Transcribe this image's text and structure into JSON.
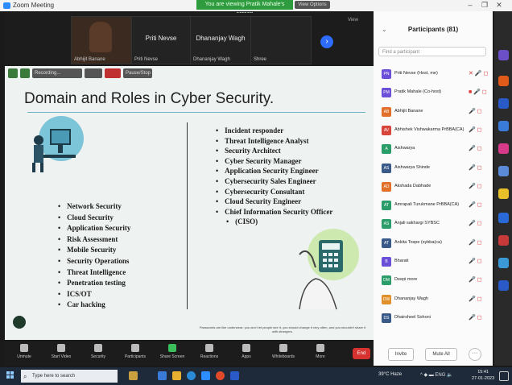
{
  "window": {
    "title": "Zoom Meeting",
    "viewing_banner": "You are viewing Pratik Mahale's screen",
    "view_options": "View Options",
    "controls": [
      "–",
      "❐",
      "✕"
    ]
  },
  "video_strip": {
    "tiles": [
      {
        "name": "Abhijit Banane",
        "big": ""
      },
      {
        "name": "Priti Nevse",
        "big": "Priti Nevse"
      },
      {
        "name": "Dhananjay Wagh",
        "big": "Dhananjay Wagh"
      },
      {
        "name": "Shree",
        "big": ""
      }
    ],
    "view_label": "View"
  },
  "slide_controls": [
    "",
    "",
    "Recording...",
    "",
    "Pause/Stop"
  ],
  "slide": {
    "title": "Domain and Roles in Cyber Security.",
    "left_bullets": [
      "Network Security",
      "Cloud Security",
      "Application Security",
      "Risk Assessment",
      "Mobile Security",
      "Security Operations",
      "Threat Intelligence",
      "Penetration testing",
      "ICS/OT",
      "Car hacking"
    ],
    "right_bullets": [
      "Incident responder",
      "Threat Intelligence Analyst",
      "Security Architect",
      "Cyber Security Manager",
      "Application Security Engineer",
      "Cybersecurity Sales Engineer",
      "Cybersecurity Consultant",
      "Cloud Security Engineer",
      "Chief Information Security Officer"
    ],
    "right_tail": "(CISO)",
    "footnote": "Passwords are like underwear: you don't let people see it, you should change it very often, and you shouldn't share it with strangers."
  },
  "participants": {
    "title": "Participants (81)",
    "search_placeholder": "Find a participant",
    "list": [
      {
        "initials": "PN",
        "name": "Priti Nevse (Host, me)",
        "color": "#6b4fd8",
        "icon": "✕ 🎤 ◻"
      },
      {
        "initials": "PM",
        "name": "Pratik Mahale (Co-host)",
        "color": "#6b4fd8",
        "icon": "■ 🎤 ◻"
      },
      {
        "initials": "AB",
        "name": "Abhijit Banane",
        "color": "#e0702a",
        "icon": "🎤 ◻"
      },
      {
        "initials": "AV",
        "name": "Abhishek Vishwakarma PrBBA(CA)",
        "color": "#d8453a",
        "icon": "🎤 ◻"
      },
      {
        "initials": "A",
        "name": "Aishwarya",
        "color": "#2a9d6a",
        "icon": "🎤 ◻"
      },
      {
        "initials": "AS",
        "name": "Aishwarya Shinde",
        "color": "#3a5a8a",
        "icon": "🎤 ◻"
      },
      {
        "initials": "AD",
        "name": "Akshada Dabhade",
        "color": "#e0702a",
        "icon": "🎤 ◻"
      },
      {
        "initials": "AT",
        "name": "Amrapali Turukmane PrBBA(CA)",
        "color": "#2a9d6a",
        "icon": "🎤 ◻"
      },
      {
        "initials": "AS",
        "name": "Anjali sakhargi SYBSC",
        "color": "#2a9d6a",
        "icon": "🎤 ◻"
      },
      {
        "initials": "AT",
        "name": "Ankita Tospe (sybba(ca)",
        "color": "#3a5a8a",
        "icon": "🎤 ◻"
      },
      {
        "initials": "B",
        "name": "Bharati",
        "color": "#6b4fd8",
        "icon": "🎤 ◻"
      },
      {
        "initials": "DM",
        "name": "Deepi more",
        "color": "#2a9d6a",
        "icon": "🎤 ◻"
      },
      {
        "initials": "DW",
        "name": "Dhananjay Wagh",
        "color": "#e0902a",
        "icon": "🎤 ◻"
      },
      {
        "initials": "DS",
        "name": "Dhairsheel Sohoni",
        "color": "#3a5a8a",
        "icon": "🎤 ◻"
      }
    ],
    "invite": "Invite",
    "mute_all": "Mute All",
    "more": "···"
  },
  "toolbar": {
    "items": [
      "Unmute",
      "Start Video",
      "Security",
      "Participants",
      "Share Screen",
      "Reactions",
      "Apps",
      "Whiteboards",
      "More"
    ],
    "end": "End"
  },
  "taskbar": {
    "search_placeholder": "Type here to search",
    "weather": "39°C Haze",
    "tray": "^ ◆ ▬ ENG 🔈",
    "time": "15:41",
    "date": "27-01-2023"
  },
  "colors": {
    "accent": "#2d8cff",
    "end": "#d6322f",
    "share": "#3bbf5a"
  }
}
